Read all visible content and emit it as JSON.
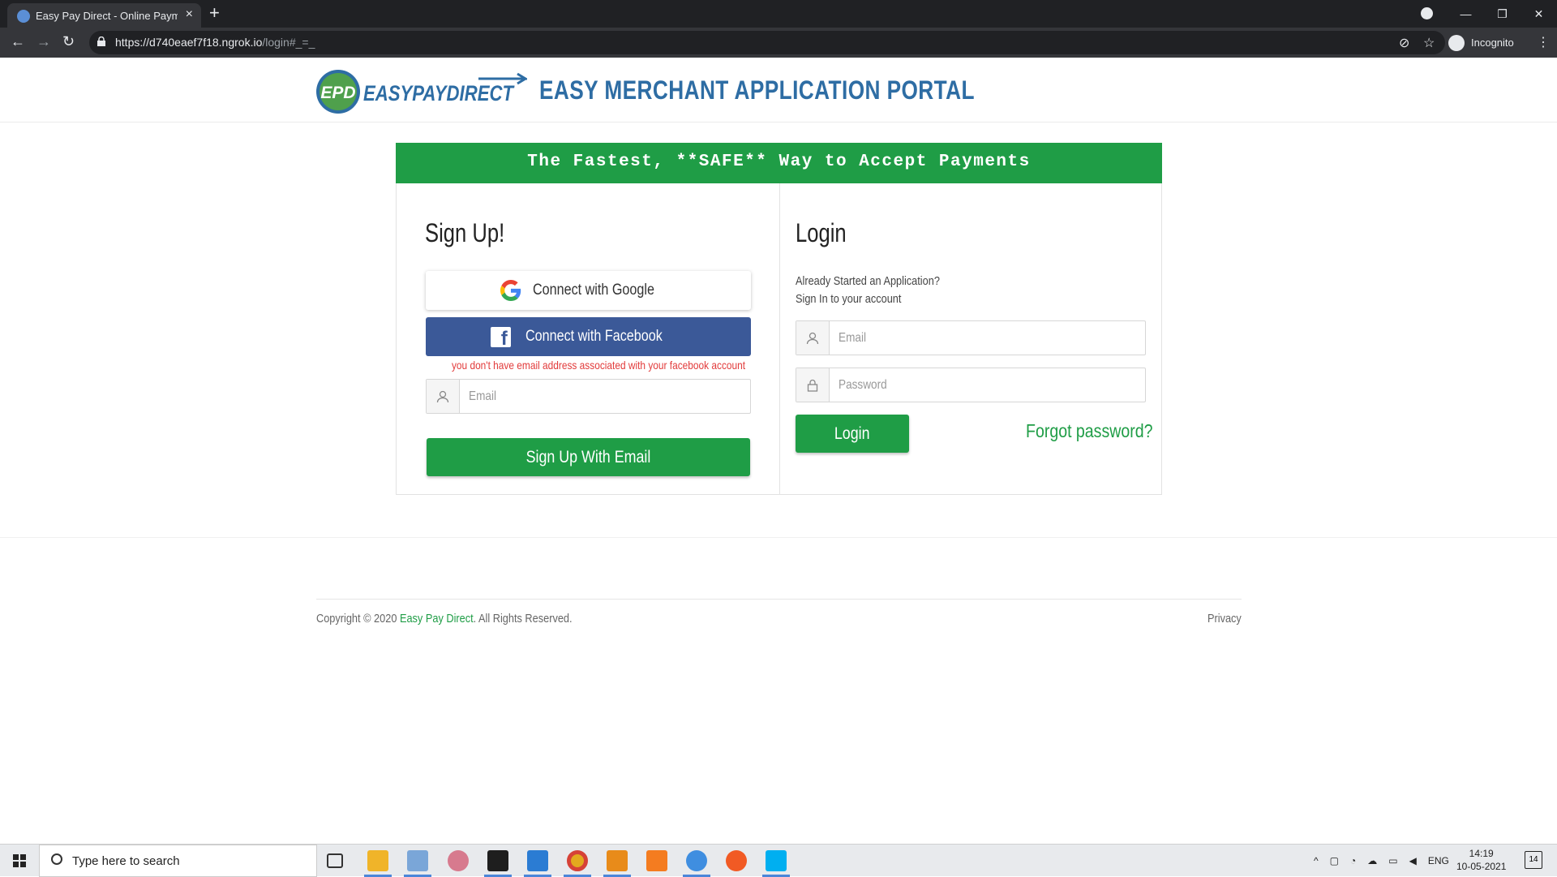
{
  "browser": {
    "tab_title": "Easy Pay Direct - Online Payment",
    "url_main": "https://d740eaef7f18.ngrok.io",
    "url_path": "/login#_=_",
    "profile_label": "Incognito"
  },
  "header": {
    "logo_text": "EASYPAYDIRECT",
    "logo_badge": "EPD",
    "portal_title": "EASY MERCHANT APPLICATION PORTAL"
  },
  "banner": {
    "text": "The Fastest, **SAFE** Way to Accept Payments"
  },
  "signup": {
    "heading": "Sign Up!",
    "google_label": "Connect with Google",
    "facebook_label": "Connect with Facebook",
    "facebook_error": "you don't have email address associated with your facebook account",
    "email_placeholder": "Email",
    "submit_label": "Sign Up With Email"
  },
  "login": {
    "heading": "Login",
    "subtitle_line1": "Already Started an Application?",
    "subtitle_line2": "Sign In to your account",
    "email_placeholder": "Email",
    "password_placeholder": "Password",
    "submit_label": "Login",
    "forgot_label": "Forgot password?"
  },
  "footer": {
    "copyright_prefix": "Copyright © 2020 ",
    "company_link": "Easy Pay Direct",
    "copyright_suffix": ". All Rights Reserved.",
    "privacy_label": "Privacy"
  },
  "taskbar": {
    "search_placeholder": "Type here to search",
    "language": "ENG",
    "time": "14:19",
    "date": "10-05-2021",
    "notification_count": "14"
  },
  "colors": {
    "brand_green": "#1f9d46",
    "brand_blue": "#2e6da4",
    "facebook_blue": "#3b5998",
    "error_red": "#e23b3b"
  }
}
